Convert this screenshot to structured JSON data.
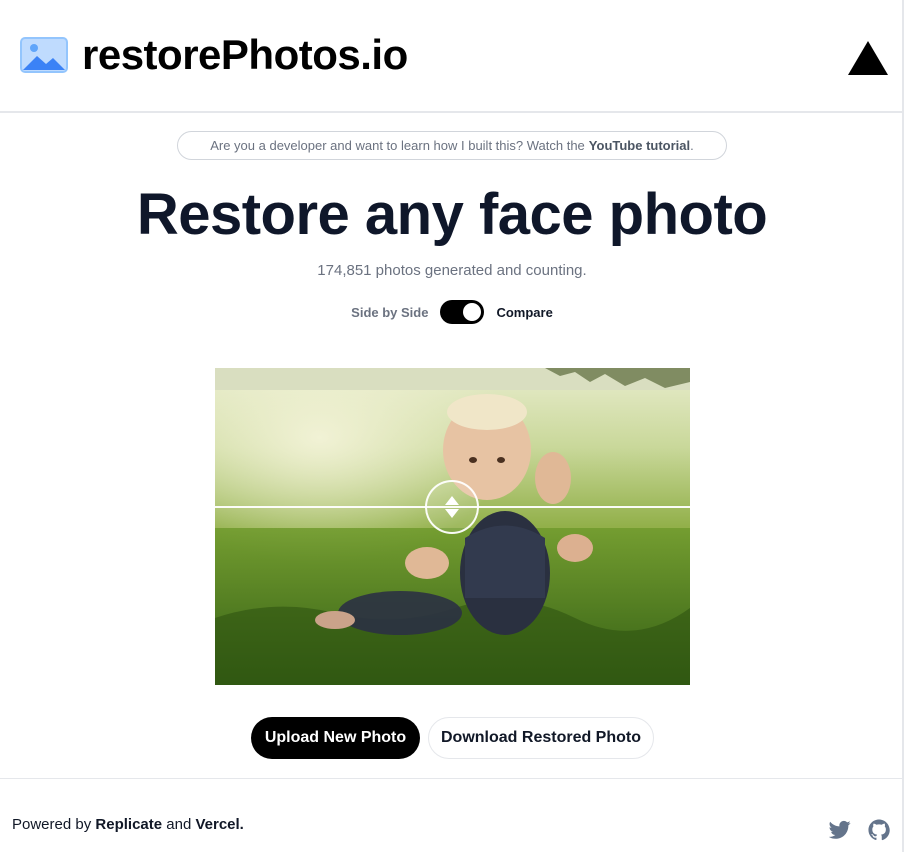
{
  "header": {
    "logo_text": "restorePhotos.io",
    "logo_icon": "image-icon",
    "vercel_icon": "vercel-triangle-icon"
  },
  "banner": {
    "text": "Are you a developer and want to learn how I built this? Watch the",
    "link": "YouTube tutorial",
    "end": "."
  },
  "hero": {
    "title": "Restore any face photo",
    "counter": "174,851 photos generated and counting."
  },
  "toggle": {
    "left_label": "Side by Side",
    "right_label": "Compare",
    "state": "on"
  },
  "compare": {
    "slider_position": 0.44,
    "handle_icon": "up-down-arrows-icon"
  },
  "buttons": {
    "upload": "Upload New Photo",
    "download": "Download Restored Photo"
  },
  "footer": {
    "powered_prefix": "Powered by",
    "replicate": "Replicate",
    "and": "and",
    "vercel": "Vercel.",
    "twitter_icon": "twitter-icon",
    "github_icon": "github-icon"
  },
  "colors": {
    "primary": "#000000",
    "text_dark": "#0f172a",
    "text_muted": "#6b7280",
    "border": "#e5e7eb",
    "logo_blue": "#60a5fa"
  }
}
